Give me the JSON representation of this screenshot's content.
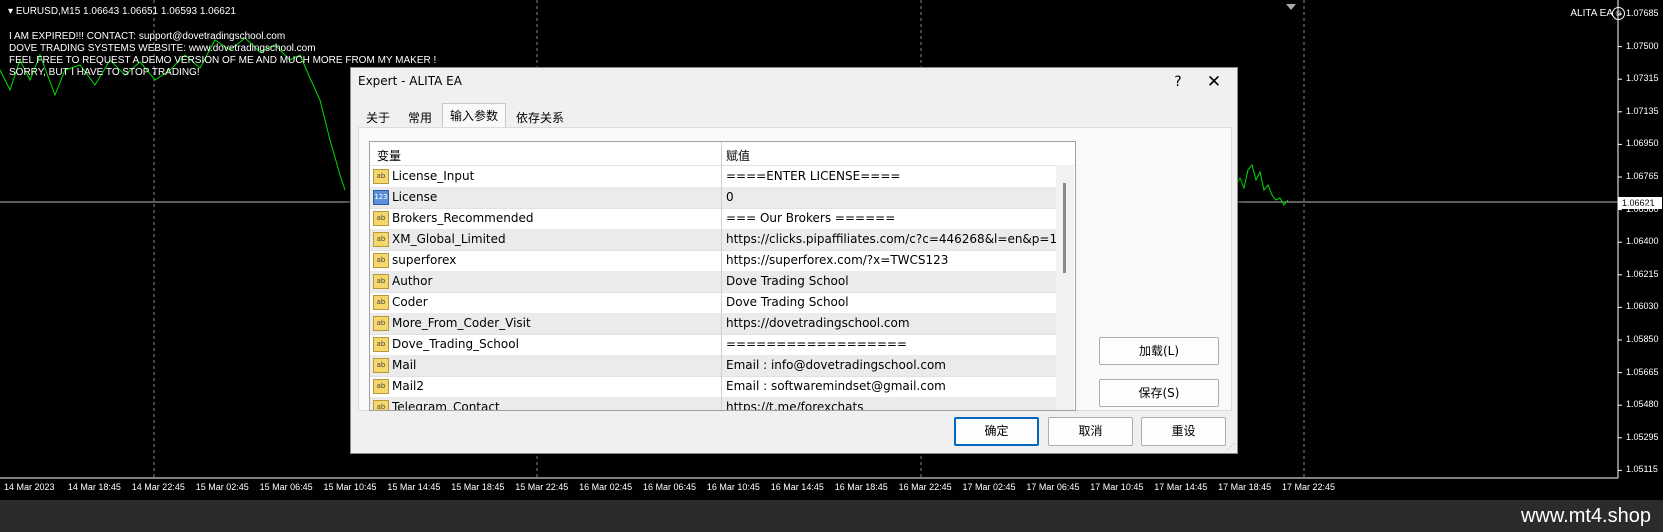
{
  "chart": {
    "symbol_line": "EURUSD,M15  1.06643 1.06651 1.06593 1.06621",
    "messages": [
      "I AM EXPIRED!!! CONTACT: support@dovetradingschool.com",
      "DOVE TRADING SYSTEMS WEBSITE: www.dovetradingschool.com",
      "FEEL FREE TO REQUEST A DEMO VERSION OF ME AND MUCH MORE FROM MY MAKER !",
      "SORRY, BUT I HAVE TO STOP TRADING!"
    ],
    "ea_label": "ALITA EA",
    "current_price": "1.06621",
    "price_axis": [
      "1.07685",
      "1.07500",
      "1.07315",
      "1.07135",
      "1.06950",
      "1.06765",
      "1.06580",
      "1.06400",
      "1.06215",
      "1.06030",
      "1.05850",
      "1.05665",
      "1.05480",
      "1.05295",
      "1.05115"
    ],
    "time_axis": [
      "14 Mar 2023",
      "14 Mar 18:45",
      "14 Mar 22:45",
      "15 Mar 02:45",
      "15 Mar 06:45",
      "15 Mar 10:45",
      "15 Mar 14:45",
      "15 Mar 18:45",
      "15 Mar 22:45",
      "16 Mar 02:45",
      "16 Mar 06:45",
      "16 Mar 10:45",
      "16 Mar 14:45",
      "16 Mar 18:45",
      "16 Mar 22:45",
      "17 Mar 02:45",
      "17 Mar 06:45",
      "17 Mar 10:45",
      "17 Mar 14:45",
      "17 Mar 18:45",
      "17 Mar 22:45"
    ],
    "watermark": "www.mt4.shop"
  },
  "dialog": {
    "title": "Expert - ALITA EA",
    "help": "?",
    "close": "✕",
    "tabs": [
      "关于",
      "常用",
      "输入参数",
      "依存关系"
    ],
    "col_variable": "变量",
    "col_value": "赋值",
    "rows": [
      {
        "icon": "ab",
        "name": "License_Input",
        "value": "====ENTER LICENSE===="
      },
      {
        "icon": "123",
        "name": "License",
        "value": "0"
      },
      {
        "icon": "ab",
        "name": "Brokers_Recommended",
        "value": "=== Our Brokers ======"
      },
      {
        "icon": "ab",
        "name": "XM_Global_Limited",
        "value": "https://clicks.pipaffiliates.com/c?c=446268&l=en&p=1"
      },
      {
        "icon": "ab",
        "name": "superforex",
        "value": "https://superforex.com/?x=TWCS123"
      },
      {
        "icon": "ab",
        "name": "Author",
        "value": "Dove Trading School"
      },
      {
        "icon": "ab",
        "name": "Coder",
        "value": "Dove Trading School"
      },
      {
        "icon": "ab",
        "name": "More_From_Coder_Visit",
        "value": "https://dovetradingschool.com"
      },
      {
        "icon": "ab",
        "name": "Dove_Trading_School",
        "value": "=================="
      },
      {
        "icon": "ab",
        "name": "Mail",
        "value": "Email : info@dovetradingschool.com"
      },
      {
        "icon": "ab",
        "name": "Mail2",
        "value": "Email : softwaremindset@gmail.com"
      },
      {
        "icon": "ab",
        "name": "Telegram_Contact",
        "value": "https://t.me/forexchats"
      }
    ],
    "load_label": "加载(L)",
    "save_label": "保存(S)",
    "ok_label": "确定",
    "cancel_label": "取消",
    "reset_label": "重设"
  }
}
